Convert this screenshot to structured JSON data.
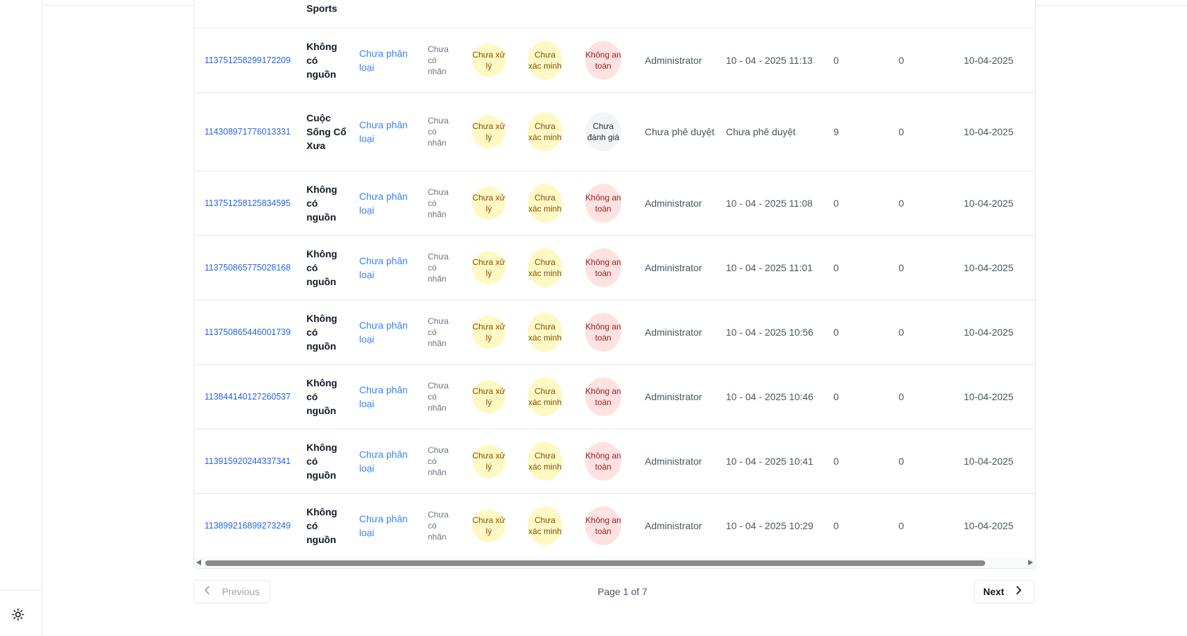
{
  "table": {
    "partial_row_source": "Sports",
    "rows": [
      {
        "id": "113751258299172209",
        "source": "Không có nguồn",
        "category": "Chưa phân loại",
        "label": "Chưa có nhãn",
        "process": "Chưa xử lý",
        "verify": "Chưa xác minh",
        "safety": "Không an toàn",
        "safety_type": "unsafe",
        "user": "Administrator",
        "time": "10 - 04 - 2025 11:13",
        "n1": "0",
        "n2": "0",
        "date": "10-04-2025"
      },
      {
        "id": "114308971776013331",
        "source": "Cuộc Sống Cổ Xưa",
        "category": "Chưa phân loại",
        "label": "Chưa có nhãn",
        "process": "Chưa xử lý",
        "verify": "Chưa xác minh",
        "safety": "Chưa đánh giá",
        "safety_type": "neutral",
        "user": "Chưa phê duyệt",
        "time": "Chưa phê duyệt",
        "n1": "9",
        "n2": "0",
        "date": "10-04-2025"
      },
      {
        "id": "113751258125834595",
        "source": "Không có nguồn",
        "category": "Chưa phân loại",
        "label": "Chưa có nhãn",
        "process": "Chưa xử lý",
        "verify": "Chưa xác minh",
        "safety": "Không an toàn",
        "safety_type": "unsafe",
        "user": "Administrator",
        "time": "10 - 04 - 2025 11:08",
        "n1": "0",
        "n2": "0",
        "date": "10-04-2025"
      },
      {
        "id": "113750865775028168",
        "source": "Không có nguồn",
        "category": "Chưa phân loại",
        "label": "Chưa có nhãn",
        "process": "Chưa xử lý",
        "verify": "Chưa xác minh",
        "safety": "Không an toàn",
        "safety_type": "unsafe",
        "user": "Administrator",
        "time": "10 - 04 - 2025 11:01",
        "n1": "0",
        "n2": "0",
        "date": "10-04-2025"
      },
      {
        "id": "113750865446001739",
        "source": "Không có nguồn",
        "category": "Chưa phân loại",
        "label": "Chưa có nhãn",
        "process": "Chưa xử lý",
        "verify": "Chưa xác minh",
        "safety": "Không an toàn",
        "safety_type": "unsafe",
        "user": "Administrator",
        "time": "10 - 04 - 2025 10:56",
        "n1": "0",
        "n2": "0",
        "date": "10-04-2025"
      },
      {
        "id": "113844140127260537",
        "source": "Không có nguồn",
        "category": "Chưa phân loại",
        "label": "Chưa có nhãn",
        "process": "Chưa xử lý",
        "verify": "Chưa xác minh",
        "safety": "Không an toàn",
        "safety_type": "unsafe",
        "user": "Administrator",
        "time": "10 - 04 - 2025 10:46",
        "n1": "0",
        "n2": "0",
        "date": "10-04-2025"
      },
      {
        "id": "113915920244337341",
        "source": "Không có nguồn",
        "category": "Chưa phân loại",
        "label": "Chưa có nhãn",
        "process": "Chưa xử lý",
        "verify": "Chưa xác minh",
        "safety": "Không an toàn",
        "safety_type": "unsafe",
        "user": "Administrator",
        "time": "10 - 04 - 2025 10:41",
        "n1": "0",
        "n2": "0",
        "date": "10-04-2025"
      },
      {
        "id": "113899216899273249",
        "source": "Không có nguồn",
        "category": "Chưa phân loại",
        "label": "Chưa có nhãn",
        "process": "Chưa xử lý",
        "verify": "Chưa xác minh",
        "safety": "Không an toàn",
        "safety_type": "unsafe",
        "user": "Administrator",
        "time": "10 - 04 - 2025 10:29",
        "n1": "0",
        "n2": "0",
        "date": "10-04-2025"
      }
    ]
  },
  "pagination": {
    "previous_label": "Previous",
    "next_label": "Next",
    "page_info": "Page 1 of 7"
  },
  "icons": {
    "theme_toggle": "sun-icon",
    "previous": "chevron-left-icon",
    "next": "chevron-right-icon"
  },
  "colors": {
    "link": "#2563eb",
    "category": "#3b82f6",
    "pending_badge_bg": "#fef9c3",
    "pending_badge_text": "#854d0e",
    "unsafe_badge_bg": "#fee2e2",
    "unsafe_badge_text": "#991b1b",
    "neutral_badge_bg": "#f3f4f6"
  }
}
